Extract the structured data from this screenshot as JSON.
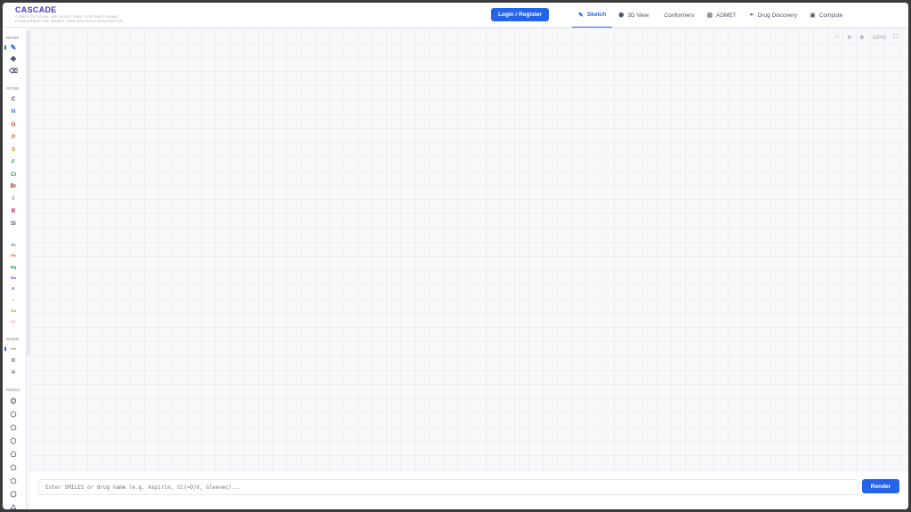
{
  "app": {
    "title": "CASCADE",
    "subtitle": "COMPUTATIONAL ARCHITECTURE FOR SKETCHING, CONFORMATION, ADMET, AND DOCKING EVALUATION"
  },
  "header": {
    "login_label": "Login / Register",
    "tabs": [
      {
        "label": "Sketch",
        "icon": "pencil-icon",
        "active": true
      },
      {
        "label": "3D View",
        "icon": "cube-icon",
        "active": false
      },
      {
        "label": "Conformers",
        "icon": "",
        "active": false
      },
      {
        "label": "ADMET",
        "icon": "chart-icon",
        "active": false
      },
      {
        "label": "Drug Discovery",
        "icon": "pill-icon",
        "active": false
      },
      {
        "label": "Compute",
        "icon": "cpu-icon",
        "active": false
      }
    ]
  },
  "sidebar": {
    "sections": {
      "mode": "MODE",
      "atom": "ATOM",
      "bond": "BOND",
      "rings": "RINGS"
    },
    "modes": [
      {
        "name": "draw",
        "icon": "pencil-icon",
        "active": true
      },
      {
        "name": "move",
        "icon": "move-icon",
        "active": false
      },
      {
        "name": "erase",
        "icon": "eraser-icon",
        "active": false
      }
    ],
    "atoms": [
      {
        "symbol": "C",
        "color": "#374151"
      },
      {
        "symbol": "N",
        "color": "#2563eb"
      },
      {
        "symbol": "O",
        "color": "#dc2626"
      },
      {
        "symbol": "P",
        "color": "#ea580c"
      },
      {
        "symbol": "S",
        "color": "#ca8a04"
      },
      {
        "symbol": "F",
        "color": "#16a34a"
      },
      {
        "symbol": "Cl",
        "color": "#16a34a"
      },
      {
        "symbol": "Br",
        "color": "#9a3412"
      },
      {
        "symbol": "I",
        "color": "#7c3aed"
      },
      {
        "symbol": "B",
        "color": "#be185d"
      },
      {
        "symbol": "Si",
        "color": "#475569"
      },
      {
        "symbol": "",
        "color": "#cbd5e1"
      },
      {
        "symbol": "Zn",
        "color": "#64748b"
      },
      {
        "symbol": "Fe",
        "color": "#ea580c"
      },
      {
        "symbol": "Mg",
        "color": "#16a34a"
      },
      {
        "symbol": "Na",
        "color": "#7c3aed"
      },
      {
        "symbol": "K",
        "color": "#7c3aed"
      },
      {
        "symbol": "H",
        "color": "#cbd5e1"
      },
      {
        "symbol": "Au",
        "color": "#ca8a04"
      },
      {
        "symbol": "Li",
        "color": "#f87171"
      }
    ],
    "bonds": [
      {
        "name": "single-bond",
        "glyph": "—",
        "active": true
      },
      {
        "name": "double-bond",
        "glyph": "=",
        "active": false
      },
      {
        "name": "triple-bond",
        "glyph": "≡",
        "active": false
      }
    ],
    "rings": [
      {
        "name": "benzene-ring"
      },
      {
        "name": "cyclohexane-ring"
      },
      {
        "name": "cyclopentane-ring"
      },
      {
        "name": "pyridine-ring"
      },
      {
        "name": "furan-ring"
      },
      {
        "name": "pyrrole-ring"
      },
      {
        "name": "thiophene-ring"
      },
      {
        "name": "cycloheptane-ring"
      },
      {
        "name": "cyclopropane-ring"
      }
    ]
  },
  "canvas_toolbar": {
    "zoom": "100%"
  },
  "bottom": {
    "placeholder": "Enter SMILES or drug name (e.g. Aspirin, CC(=O)O, Gleevec)...",
    "render_label": "Render"
  },
  "colors": {
    "accent": "#2563eb",
    "brand": "#4338ca"
  }
}
